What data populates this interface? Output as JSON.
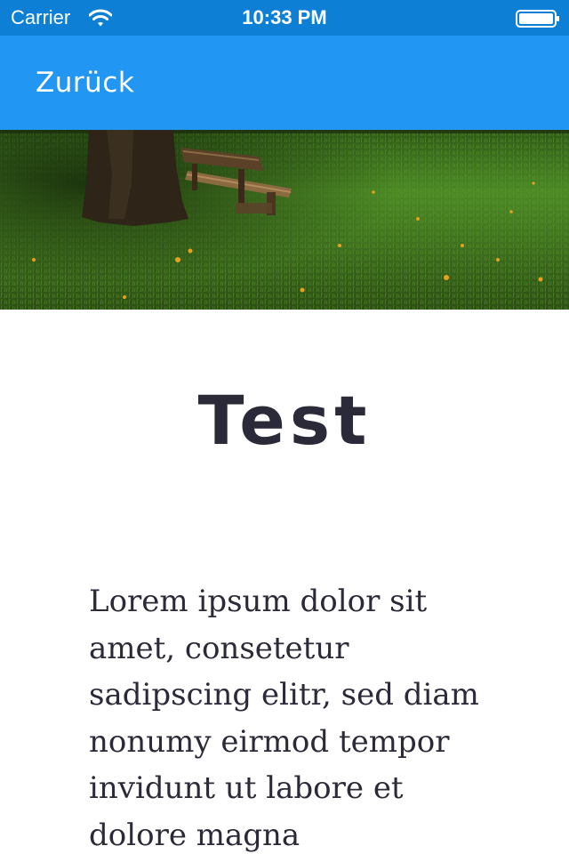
{
  "status_bar": {
    "carrier": "Carrier",
    "time": "10:33 PM",
    "wifi_icon": "wifi-icon",
    "battery_icon": "battery-icon",
    "color": "#0d80d6"
  },
  "nav_bar": {
    "back_label": "Zurück",
    "color": "#2196f3"
  },
  "hero": {
    "image": "tree-and-bench-on-grass-meadow"
  },
  "content": {
    "title": "Test",
    "body": "Lorem ipsum dolor sit amet, consetetur sadipscing elitr, sed diam nonumy eirmod tempor invidunt ut labore et dolore magna",
    "text_color": "#2b2a38"
  }
}
